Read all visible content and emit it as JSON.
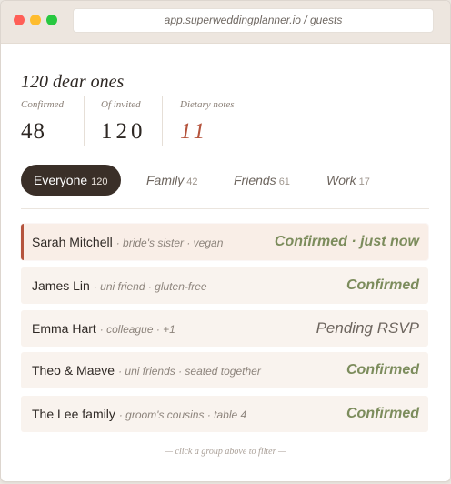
{
  "browser": {
    "url": "app.superweddingplanner.io / guests"
  },
  "header": {
    "title": "120 dear ones"
  },
  "stats": [
    {
      "label": "Confirmed",
      "value": "48"
    },
    {
      "label": "Of invited",
      "value": "120"
    },
    {
      "label": "Dietary notes",
      "value": "11"
    }
  ],
  "tabs": [
    {
      "label": "Everyone",
      "count": "120",
      "active": true
    },
    {
      "label": "Family",
      "count": "42"
    },
    {
      "label": "Friends",
      "count": "61"
    },
    {
      "label": "Work",
      "count": "17"
    }
  ],
  "guests": [
    {
      "name": "Sarah Mitchell",
      "meta": "· bride's sister · vegan",
      "status": "Confirmed · just now",
      "state": "confirmed"
    },
    {
      "name": "James Lin",
      "meta": "· uni friend · gluten-free",
      "status": "Confirmed",
      "state": "confirmed"
    },
    {
      "name": "Emma Hart",
      "meta": "· colleague · +1",
      "status": "Pending RSVP",
      "state": "pending"
    },
    {
      "name": "Theo & Maeve",
      "meta": "· uni friends · seated together",
      "status": "Confirmed",
      "state": "confirmed"
    },
    {
      "name": "The Lee family",
      "meta": "· groom's cousins · table 4",
      "status": "Confirmed",
      "state": "confirmed"
    }
  ],
  "footer": {
    "hint": "— click a group above to filter —"
  },
  "colors": {
    "accent": "#b5543d",
    "confirmed": "#7c8c5c",
    "dark": "#3a2f28"
  }
}
